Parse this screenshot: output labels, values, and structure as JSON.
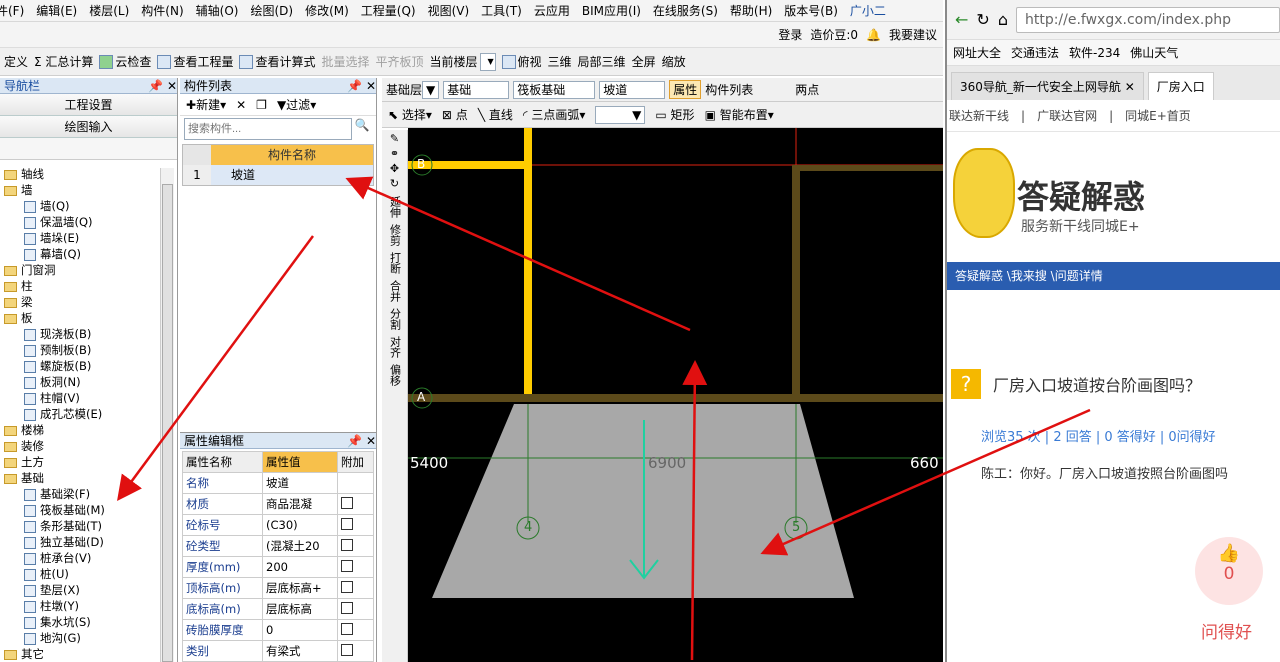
{
  "menu": [
    "楼层(L)",
    "构件(N)",
    "辅轴(O)",
    "绘图(D)",
    "修改(M)",
    "工程量(Q)",
    "视图(V)",
    "工具(T)",
    "云应用",
    "BIM应用(I)",
    "在线服务(S)",
    "帮助(H)",
    "版本号(B)",
    "广小二"
  ],
  "menu_partial": "文件(F)",
  "menu_edit": "编辑(E)",
  "topbar": {
    "login": "登录",
    "price": "造价豆:0",
    "suggest": "我要建议"
  },
  "toolbar2": {
    "define": "定义",
    "calc": "Σ 汇总计算",
    "cloud": "云检查",
    "view_qty": "查看工程量",
    "view_formula": "查看计算式",
    "batch": "批量选择",
    "flush": "平齐板顶",
    "current_floor": "当前楼层",
    "topview": "俯视",
    "three_d": "三维",
    "local_3d": "局部三维",
    "fullscreen": "全屏",
    "zoom": "缩放"
  },
  "nav": {
    "title": "导航栏",
    "project_settings": "工程设置",
    "draw_input": "绘图输入",
    "tree": [
      {
        "t": "f",
        "label": "轴线"
      },
      {
        "t": "f",
        "label": "墙"
      },
      {
        "t": "l",
        "label": "墙(Q)"
      },
      {
        "t": "l",
        "label": "保温墙(Q)"
      },
      {
        "t": "l",
        "label": "墙垛(E)"
      },
      {
        "t": "l",
        "label": "幕墙(Q)"
      },
      {
        "t": "f",
        "label": "门窗洞"
      },
      {
        "t": "f",
        "label": "柱"
      },
      {
        "t": "f",
        "label": "梁"
      },
      {
        "t": "f",
        "label": "板"
      },
      {
        "t": "l",
        "label": "现浇板(B)"
      },
      {
        "t": "l",
        "label": "预制板(B)"
      },
      {
        "t": "l",
        "label": "螺旋板(B)"
      },
      {
        "t": "l",
        "label": "板洞(N)"
      },
      {
        "t": "l",
        "label": "柱帽(V)"
      },
      {
        "t": "l",
        "label": "成孔芯模(E)"
      },
      {
        "t": "f",
        "label": "楼梯"
      },
      {
        "t": "f",
        "label": "装修"
      },
      {
        "t": "f",
        "label": "土方"
      },
      {
        "t": "f",
        "label": "基础"
      },
      {
        "t": "l",
        "label": "基础梁(F)"
      },
      {
        "t": "l",
        "label": "筏板基础(M)"
      },
      {
        "t": "l",
        "label": "条形基础(T)"
      },
      {
        "t": "l",
        "label": "独立基础(D)"
      },
      {
        "t": "l",
        "label": "桩承台(V)"
      },
      {
        "t": "l",
        "label": "桩(U)"
      },
      {
        "t": "l",
        "label": "垫层(X)"
      },
      {
        "t": "l",
        "label": "柱墩(Y)"
      },
      {
        "t": "l",
        "label": "集水坑(S)"
      },
      {
        "t": "l",
        "label": "地沟(G)"
      },
      {
        "t": "f",
        "label": "其它"
      }
    ]
  },
  "complist": {
    "title": "构件列表",
    "new": "新建",
    "filter": "过滤",
    "search_ph": "搜索构件...",
    "col": "构件名称",
    "rows": [
      {
        "no": "1",
        "name": "坡道"
      }
    ]
  },
  "props": {
    "title": "属性编辑框",
    "h1": "属性名称",
    "h2": "属性值",
    "h3": "附加",
    "rows": [
      {
        "n": "名称",
        "v": "坡道"
      },
      {
        "n": "材质",
        "v": "商品混凝"
      },
      {
        "n": "砼标号",
        "v": "(C30)"
      },
      {
        "n": "砼类型",
        "v": "(混凝土20"
      },
      {
        "n": "厚度(mm)",
        "v": "200"
      },
      {
        "n": "顶标高(m)",
        "v": "层底标高+"
      },
      {
        "n": "底标高(m)",
        "v": "层底标高"
      },
      {
        "n": "砖胎膜厚度",
        "v": "0"
      },
      {
        "n": "类别",
        "v": "有梁式"
      }
    ]
  },
  "ctb1": {
    "floor": "基础层",
    "cat": "基础",
    "type": "筏板基础",
    "comp": "坡道",
    "attr": "属性",
    "list": "构件列表",
    "twopoint": "两点"
  },
  "ctb2": {
    "select": "选择",
    "point": "点",
    "line": "直线",
    "arc": "三点画弧",
    "rect": "矩形",
    "smart": "智能布置"
  },
  "vtools": [
    "延伸",
    "修剪",
    "打断",
    "合并",
    "分割",
    "对齐",
    "偏移"
  ],
  "canvas": {
    "axis_b": "B",
    "axis_a": "A",
    "dim_left": "5400",
    "dim_mid": "6900",
    "dim_right": "660",
    "ax4": "4",
    "ax5": "5"
  },
  "browser": {
    "url": "http://e.fwxgx.com/index.php",
    "favs": [
      "网址大全",
      "交通违法",
      "软件-234",
      "佛山天气"
    ],
    "tab1": "360导航_新一代安全上网导航",
    "tab2": "厂房入口",
    "sitenav": [
      "联达新干线",
      "广联达官网",
      "同城E+首页"
    ],
    "hero_title": "答疑解惑",
    "hero_sub": "服务新干线同城E+",
    "crumb": "答疑解惑 \\我来搜 \\问题详情",
    "question": "厂房入口坡道按台阶画图吗？",
    "stats": "浏览35 次 | 2 回答 | 0 答得好 | 0问得好",
    "answer": "陈工：你好。厂房入口坡道按照台阶画图吗",
    "like": "0",
    "good_q": "问得好"
  },
  "colors": {
    "accent": "#2a5db0",
    "arrow": "#e01010",
    "canvas": "#000000",
    "ramp": "#a8a8a8"
  }
}
